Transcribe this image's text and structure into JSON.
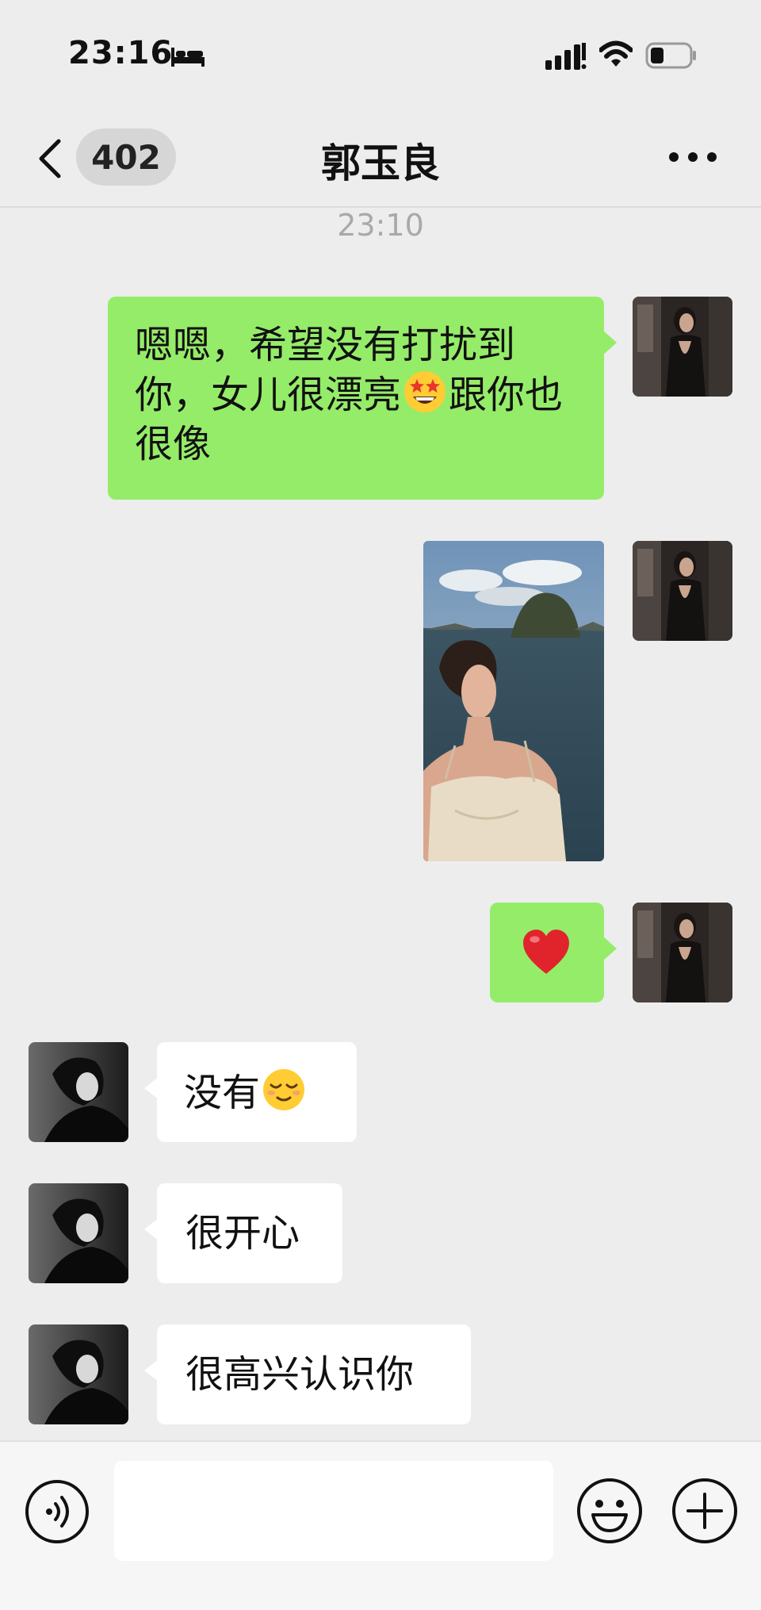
{
  "status_bar": {
    "time": "23:16",
    "icons": [
      "bed-icon",
      "cellular-signal-icon",
      "wifi-icon",
      "battery-icon"
    ]
  },
  "nav": {
    "back_icon": "chevron-left-icon",
    "unread_count": "402",
    "title": "郭玉良",
    "more_icon": "more-dots-icon"
  },
  "chat": {
    "timestamp": "23:10",
    "messages": [
      {
        "direction": "out",
        "type": "text",
        "text_before": "嗯嗯，希望没有打扰到你，女儿很漂亮",
        "emoji": "star-struck-emoji",
        "text_after": "跟你也很像"
      },
      {
        "direction": "out",
        "type": "image",
        "alt_icon": "photo-woman-by-sea"
      },
      {
        "direction": "out",
        "type": "emoji",
        "emoji": "❤️"
      },
      {
        "direction": "in",
        "type": "text",
        "text": "没有",
        "emoji": "relieved-face-emoji"
      },
      {
        "direction": "in",
        "type": "text",
        "text": "很开心"
      },
      {
        "direction": "in",
        "type": "text",
        "text": "很高兴认识你"
      }
    ]
  },
  "input_bar": {
    "voice_icon": "voice-icon",
    "input_value": "",
    "emoji_icon": "emoji-icon",
    "plus_icon": "plus-icon"
  },
  "colors": {
    "background": "#ededed",
    "outgoing_bubble": "#95ec69",
    "incoming_bubble": "#ffffff",
    "timestamp": "#a9a9a9"
  }
}
